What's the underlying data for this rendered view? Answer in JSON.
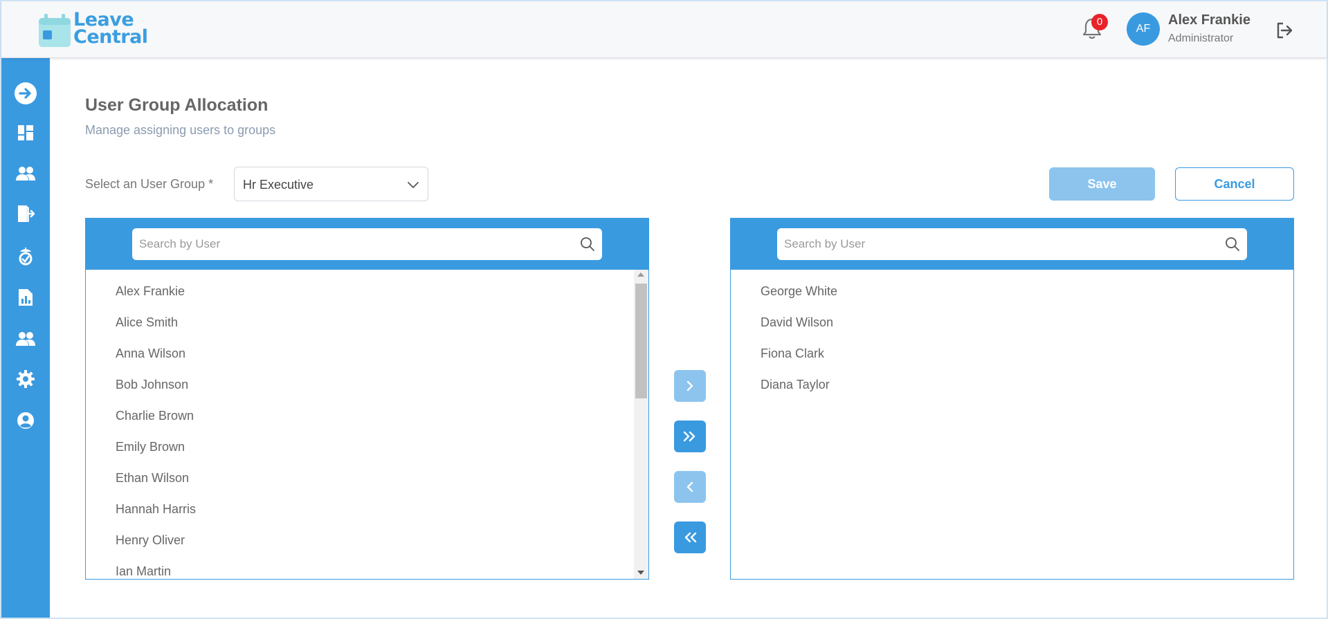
{
  "app": {
    "logo_line1": "Leave",
    "logo_line2": "Central",
    "notification_count": "0",
    "user_initials": "AF",
    "user_name": "Alex Frankie",
    "user_role": "Administrator"
  },
  "sidebar": {
    "items": [
      {
        "icon": "arrow-right-circle-icon"
      },
      {
        "icon": "dashboard-icon"
      },
      {
        "icon": "users-icon"
      },
      {
        "icon": "leave-exit-icon"
      },
      {
        "icon": "holiday-icon"
      },
      {
        "icon": "report-icon"
      },
      {
        "icon": "user-group-icon"
      },
      {
        "icon": "gear-icon"
      },
      {
        "icon": "profile-icon"
      }
    ]
  },
  "page": {
    "title": "User Group Allocation",
    "subtitle": "Manage assigning users to groups",
    "group_label": "Select an User Group *",
    "group_value": "Hr Executive",
    "save_label": "Save",
    "cancel_label": "Cancel"
  },
  "available": {
    "search_placeholder": "Search by User",
    "users": [
      "Alex Frankie",
      "Alice Smith",
      "Anna Wilson",
      "Bob Johnson",
      "Charlie Brown",
      "Emily Brown",
      "Ethan Wilson",
      "Hannah Harris",
      "Henry Oliver",
      "Ian Martin"
    ]
  },
  "assigned": {
    "search_placeholder": "Search by User",
    "users": [
      "George White",
      "David Wilson",
      "Fiona Clark",
      "Diana Taylor"
    ]
  },
  "colors": {
    "primary": "#3a9ae0",
    "primary_light": "#8cc4ee",
    "badge": "#e8232a"
  }
}
